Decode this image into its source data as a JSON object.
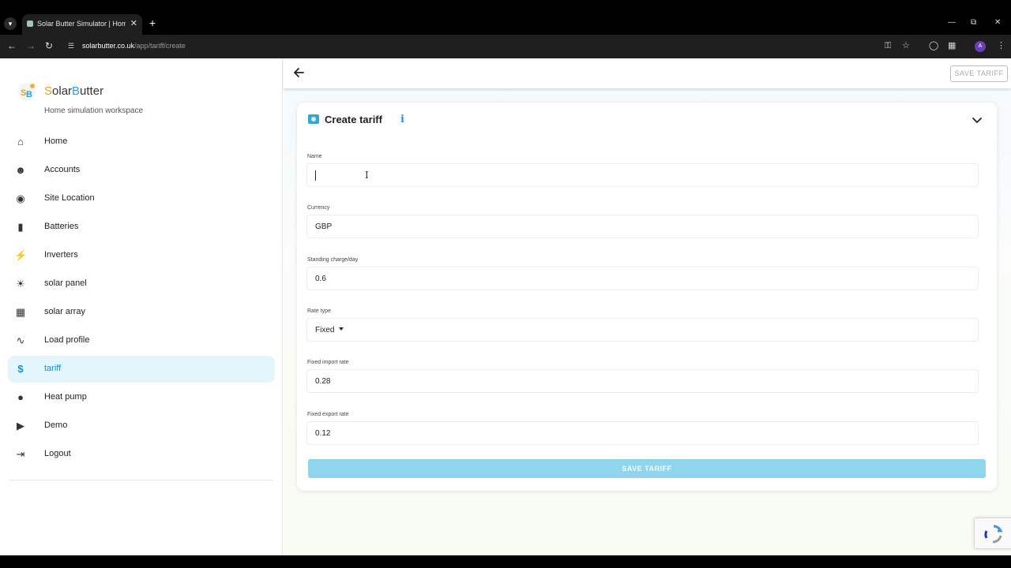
{
  "browser": {
    "tab_title": "Solar Butter Simulator | Home s",
    "new_tab": "+",
    "url_domain": "solarbutter.co.uk",
    "url_path": "/app/tariff/create",
    "profile_initial": "A"
  },
  "sidebar": {
    "brand_s": "S",
    "brand_olar": "olar",
    "brand_b": "B",
    "brand_utter": "utter",
    "tagline": "Home simulation workspace",
    "items": [
      {
        "label": "Home",
        "icon": "home-icon"
      },
      {
        "label": "Accounts",
        "icon": "people-icon"
      },
      {
        "label": "Site Location",
        "icon": "location-pin-icon"
      },
      {
        "label": "Batteries",
        "icon": "battery-icon"
      },
      {
        "label": "Inverters",
        "icon": "bolt-icon"
      },
      {
        "label": "solar panel",
        "icon": "sun-icon"
      },
      {
        "label": "solar array",
        "icon": "grid-icon"
      },
      {
        "label": "Load profile",
        "icon": "trend-line-icon"
      },
      {
        "label": "tariff",
        "icon": "dollar-icon"
      },
      {
        "label": "Heat pump",
        "icon": "flame-icon"
      },
      {
        "label": "Demo",
        "icon": "play-circle-icon"
      },
      {
        "label": "Logout",
        "icon": "logout-icon"
      }
    ],
    "active": "tariff"
  },
  "topbar": {
    "save_label": "SAVE TARIFF"
  },
  "card": {
    "title": "Create tariff",
    "info_glyph": "i",
    "fields": [
      {
        "label": "Name",
        "value": ""
      },
      {
        "label": "Currency",
        "value": "GBP"
      },
      {
        "label": "Standing charge/day",
        "value": "0.6"
      },
      {
        "label": "Rate type",
        "value": "Fixed"
      },
      {
        "label": "Fixed import rate",
        "value": "0.28"
      },
      {
        "label": "Fixed export rate",
        "value": "0.12"
      }
    ],
    "save_label": "SAVE TARIFF"
  },
  "colors": {
    "accent": "#1596c9",
    "active_bg": "#e2f6fc",
    "save_button": "#8fd6ec",
    "brand_orange": "#e4a21b"
  }
}
